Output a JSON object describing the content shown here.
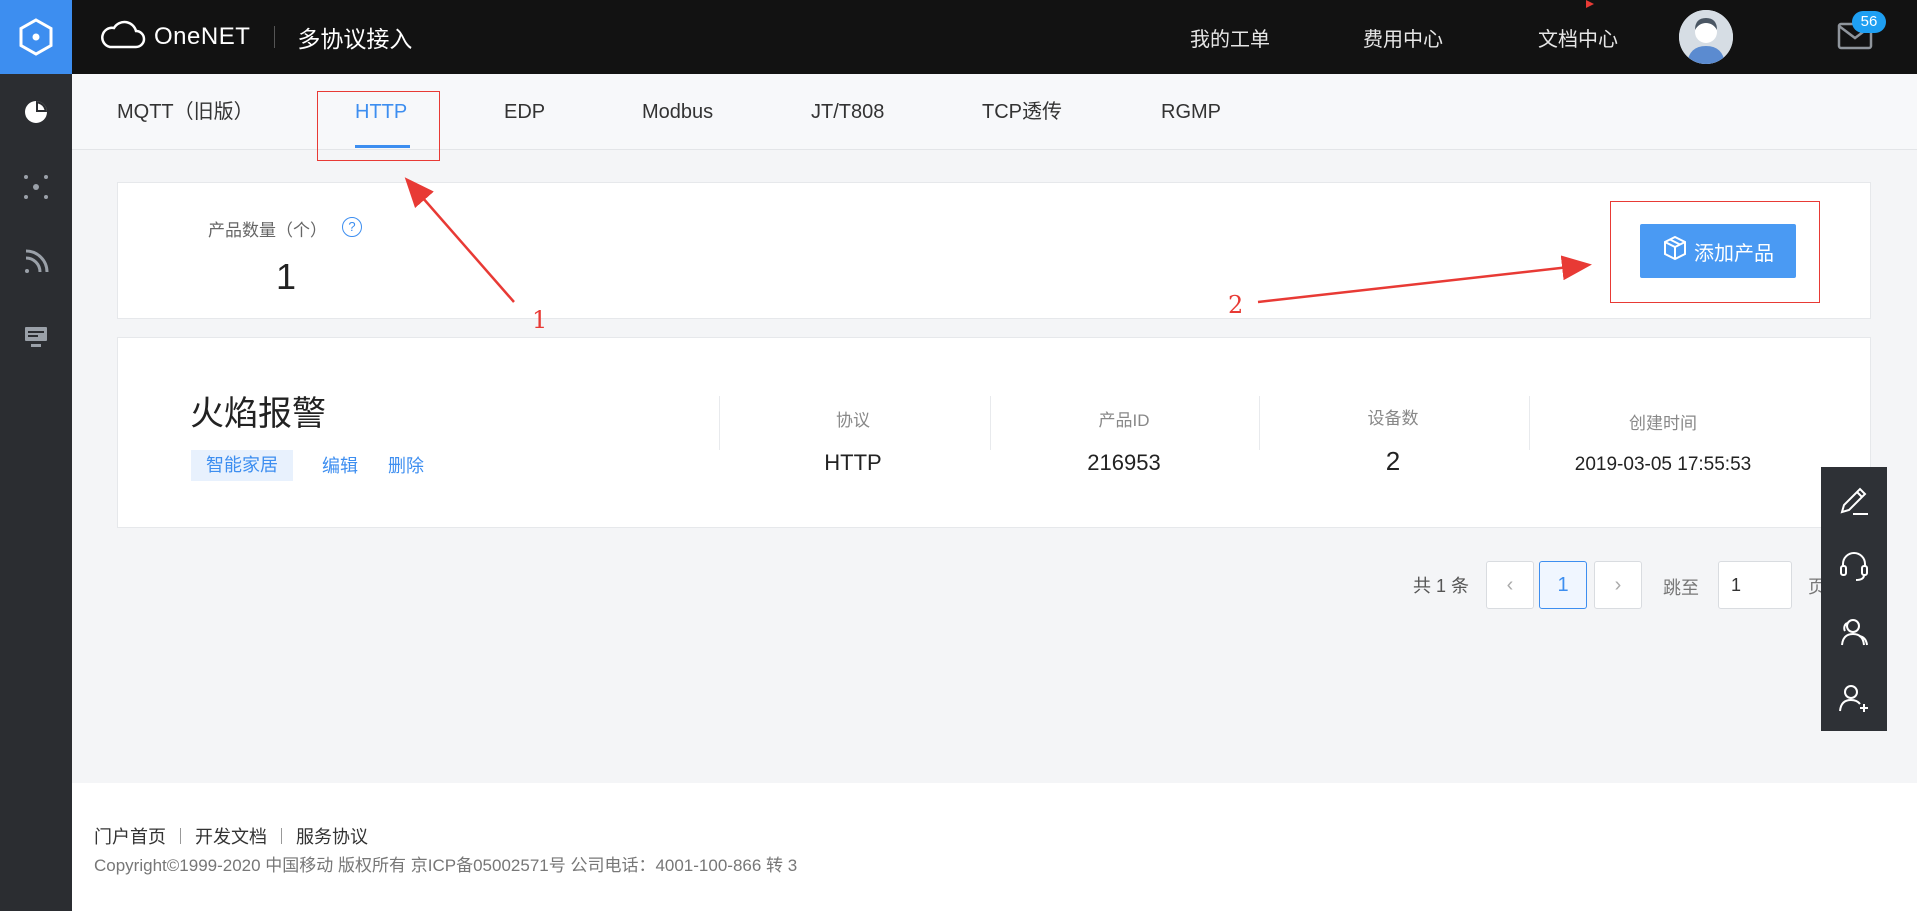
{
  "app": {
    "brand_name": "OneNET",
    "section_title": "多协议接入"
  },
  "topnav": {
    "items": [
      "我的工单",
      "费用中心",
      "文档中心"
    ],
    "mail_badge": "56"
  },
  "sidebar": {
    "icons": [
      "logo-hexagon-icon",
      "pie-chart-icon",
      "network-nodes-icon",
      "rss-icon",
      "monitor-icon"
    ]
  },
  "tabs": {
    "items": [
      "MQTT（旧版）",
      "HTTP",
      "EDP",
      "Modbus",
      "JT/T808",
      "TCP透传",
      "RGMP"
    ],
    "active": "HTTP"
  },
  "stats": {
    "label": "产品数量（个）",
    "help": "?",
    "value": "1",
    "add_button": "添加产品"
  },
  "product": {
    "name": "火焰报警",
    "tag": "智能家居",
    "edit": "编辑",
    "delete": "删除",
    "columns": [
      {
        "header": "协议",
        "value": "HTTP"
      },
      {
        "header": "产品ID",
        "value": "216953"
      },
      {
        "header": "设备数",
        "value": "2"
      },
      {
        "header": "创建时间",
        "value": "2019-03-05 17:55:53"
      }
    ]
  },
  "pagination": {
    "total": "共 1 条",
    "prev": "‹",
    "current": "1",
    "next": "›",
    "jump_label": "跳至",
    "jump_value": "1",
    "page_suffix": "页"
  },
  "floatbar": {
    "icons": [
      "edit-icon",
      "headset-icon",
      "users-icon",
      "add-user-icon"
    ]
  },
  "footer": {
    "links": [
      "门户首页",
      "开发文档",
      "服务协议"
    ],
    "copyright": "Copyright©1999-2020 中国移动 版权所有 京ICP备05002571号 公司电话：4001-100-866 转 3"
  },
  "annotations": {
    "labels": [
      "1",
      "2"
    ],
    "color": "#e83a35"
  },
  "colors": {
    "accent": "#3d8ef0",
    "topbar": "#121212",
    "rail": "#2b2d31"
  }
}
